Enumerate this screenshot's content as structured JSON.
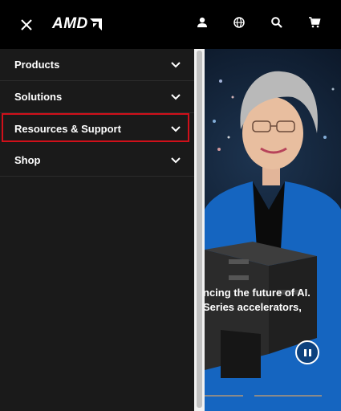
{
  "header": {
    "logo_text": "AMD",
    "icons": [
      "close-icon",
      "user-icon",
      "globe-icon",
      "search-icon",
      "cart-icon"
    ]
  },
  "menu": {
    "items": [
      {
        "label": "Products"
      },
      {
        "label": "Solutions"
      },
      {
        "label": "Resources & Support",
        "highlighted": true
      },
      {
        "label": "Shop"
      }
    ]
  },
  "hero": {
    "headline_line1": "ncing the future of AI.",
    "headline_line2": "Series accelerators,",
    "pause_icon": "pause-icon"
  },
  "colors": {
    "header_bg": "#000000",
    "drawer_bg": "#1a1a1a",
    "highlight": "#d0101a"
  }
}
